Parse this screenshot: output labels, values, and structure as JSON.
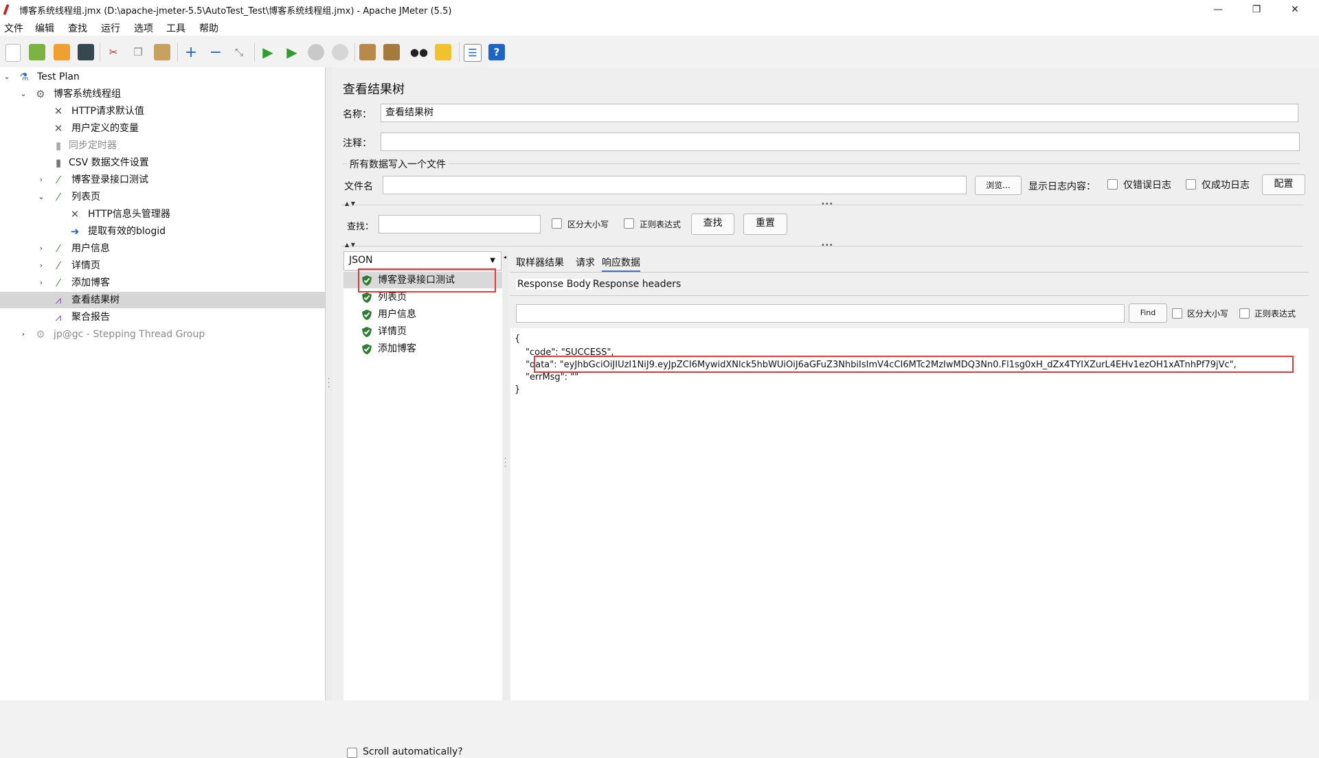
{
  "window": {
    "title": "博客系统线程组.jmx (D:\\apache-jmeter-5.5\\AutoTest_Test\\博客系统线程组.jmx) - Apache JMeter (5.5)",
    "minimize": "—",
    "maximize": "❐",
    "close": "✕"
  },
  "menu": [
    "文件",
    "编辑",
    "查找",
    "运行",
    "选项",
    "工具",
    "帮助"
  ],
  "tree": {
    "items": [
      {
        "label": "Test Plan",
        "icon": "flask-icon"
      },
      {
        "label": "博客系统线程组",
        "icon": "gear-icon"
      },
      {
        "label": "HTTP请求默认值",
        "icon": "wrench-icon"
      },
      {
        "label": "用户定义的变量",
        "icon": "wrench-icon"
      },
      {
        "label": "同步定时器",
        "icon": "timer-icon"
      },
      {
        "label": "CSV 数据文件设置",
        "icon": "file-icon"
      },
      {
        "label": "博客登录接口测试",
        "icon": "pipette-icon"
      },
      {
        "label": "列表页",
        "icon": "pipette-icon"
      },
      {
        "label": "HTTP信息头管理器",
        "icon": "wrench-icon"
      },
      {
        "label": "提取有效的blogid",
        "icon": "extractor-icon"
      },
      {
        "label": "用户信息",
        "icon": "pipette-icon"
      },
      {
        "label": "详情页",
        "icon": "pipette-icon"
      },
      {
        "label": "添加博客",
        "icon": "pipette-icon"
      },
      {
        "label": "查看结果树",
        "icon": "graph-icon"
      },
      {
        "label": "聚合报告",
        "icon": "graph-icon"
      },
      {
        "label": "jp@gc - Stepping Thread Group",
        "icon": "gear-icon"
      }
    ]
  },
  "panel": {
    "title": "查看结果树",
    "name_label": "名称：",
    "name_value": "查看结果树",
    "comment_label": "注释：",
    "comment_value": "",
    "file_group_label": "所有数据写入一个文件",
    "filename_label": "文件名",
    "filename_value": "",
    "browse_button": "浏览...",
    "log_display_label": "显示日志内容：",
    "errors_only_label": "仅错误日志",
    "success_only_label": "仅成功日志",
    "config_button": "配置",
    "search_label": "查找：",
    "search_value": "",
    "case_sensitive_label": "区分大小写",
    "regex_label": "正则表达式",
    "search_button": "查找",
    "reset_button": "重置"
  },
  "results": {
    "renderer": "JSON",
    "samples": [
      "博客登录接口测试",
      "列表页",
      "用户信息",
      "详情页",
      "添加博客"
    ],
    "scroll_auto_label": "Scroll automatically?",
    "tabs": [
      "取样器结果",
      "请求",
      "响应数据"
    ],
    "active_tab": "响应数据",
    "subtabs": [
      "Response Body",
      "Response headers"
    ],
    "find_value": "",
    "find_button": "Find",
    "find_case_label": "区分大小写",
    "find_regex_label": "正则表达式",
    "body_lines": [
      "{",
      "\"code\": \"SUCCESS\",",
      "\"data\": \"eyJhbGciOiJIUzI1NiJ9.eyJpZCI6MywidXNlck5hbWUiOiJ6aGFuZ3NhbiIsImV4cCI6MTc2MzIwMDQ3Nn0.Fl1sg0xH_dZx4TYIXZurL4EHv1ezOH1xATnhPf79jVc\",",
      "\"errMsg\": \"\"",
      "}"
    ]
  },
  "colors": {
    "highlight_red": "#e53935",
    "success_green": "#2e7d32",
    "selection": "#d6d6d6"
  }
}
